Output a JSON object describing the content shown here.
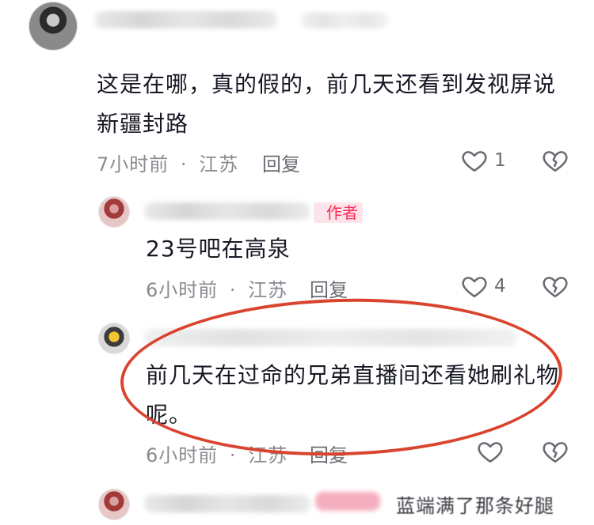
{
  "comments": [
    {
      "text": "这是在哪，真的假的，前几天还看到发视屏说新疆封路",
      "time": "7小时前",
      "location": "江苏",
      "reply_label": "回复",
      "like_count": "1"
    },
    {
      "author_badge": "作者",
      "text": "23号吧在高泉",
      "time": "6小时前",
      "location": "江苏",
      "reply_label": "回复",
      "like_count": "4"
    },
    {
      "text": "前几天在过命的兄弟直播间还看她刷礼物呢。",
      "time": "6小时前",
      "location": "江苏",
      "reply_label": "回复",
      "like_count": ""
    }
  ],
  "separator": "·",
  "partial_bottom_text": "蓝端满了那条好腿",
  "partial_top_text": "作者",
  "icons": {
    "like": "heart-outline-icon",
    "dislike": "broken-heart-icon"
  },
  "colors": {
    "annotation_circle": "#d9442f",
    "author_badge_bg": "#fde3ea",
    "author_badge_fg": "#fe2c55"
  }
}
